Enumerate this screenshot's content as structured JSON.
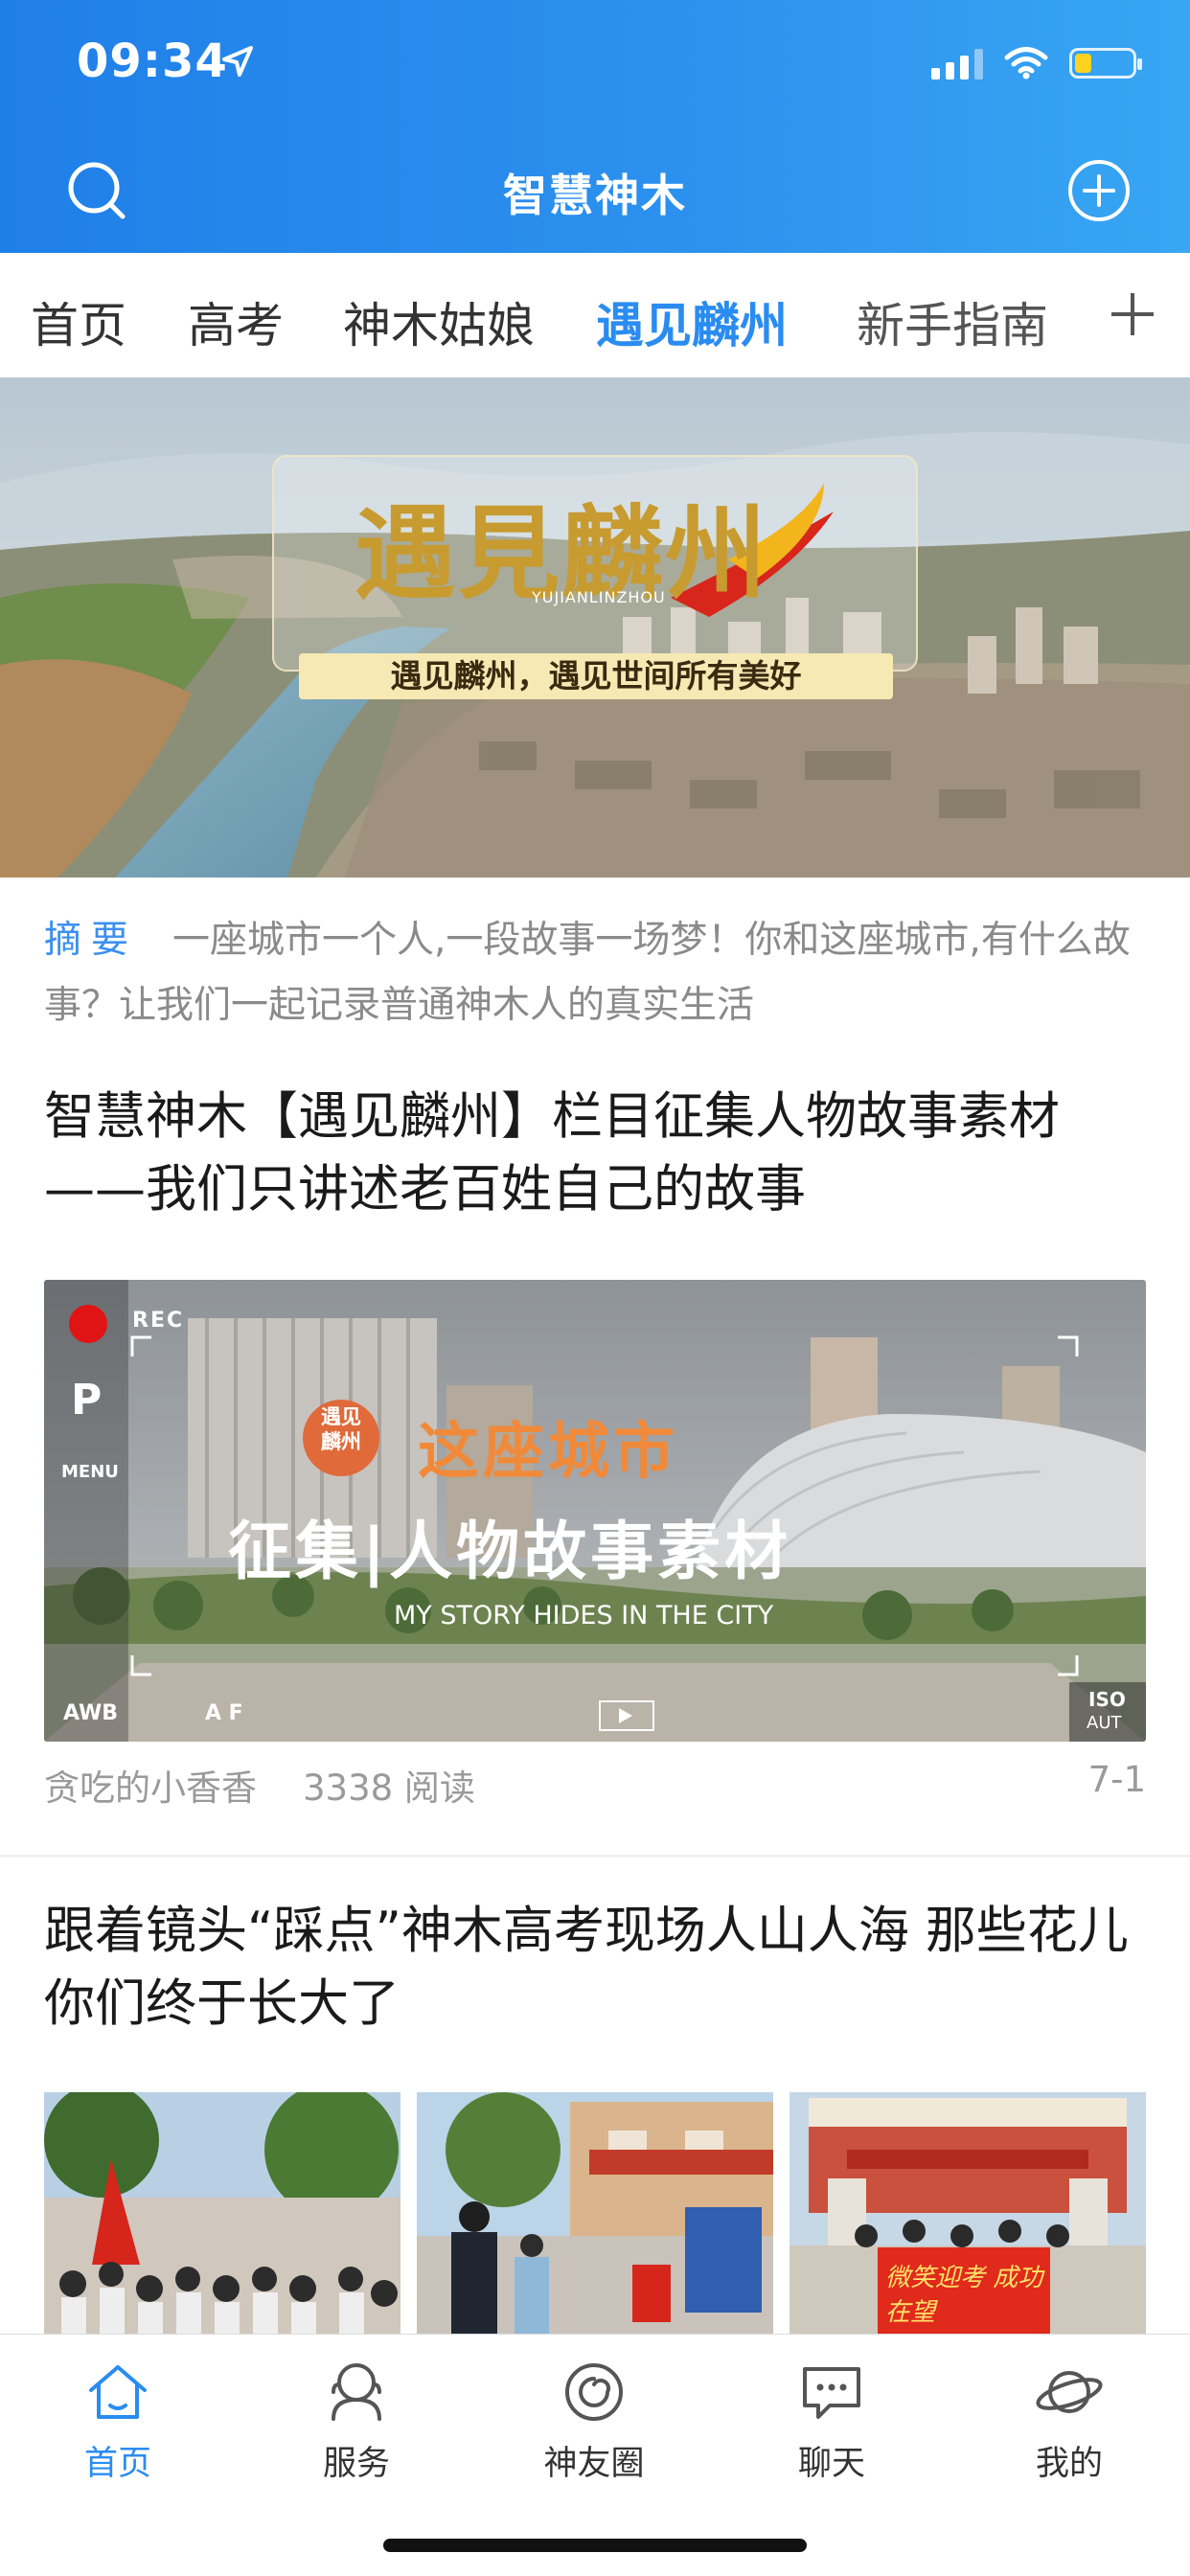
{
  "status_bar": {
    "time": "09:34",
    "battery_level": 0.3
  },
  "header": {
    "title": "智慧神木",
    "left_icon": "search-icon",
    "right_icon": "plus-circle-icon"
  },
  "tabs": [
    {
      "label": "首页",
      "active": false
    },
    {
      "label": "高考",
      "active": false
    },
    {
      "label": "神木姑娘",
      "active": false
    },
    {
      "label": "遇见麟州",
      "active": true
    },
    {
      "label": "新手指南",
      "active": false
    }
  ],
  "banner": {
    "main_text": "遇見麟州",
    "pinyin": "YUJIANLINZHOU",
    "subtitle": "遇见麟州，遇见世间所有美好"
  },
  "summary": {
    "label": "摘要",
    "text": "一座城市一个人,一段故事一场梦！你和这座城市,有什么故事？让我们一起记录普通神木人的真实生活"
  },
  "article1": {
    "title": "智慧神木【遇见麟州】栏目征集人物故事素材——我们只讲述老百姓自己的故事",
    "image": {
      "rec": "REC",
      "p": "P",
      "menu": "MENU",
      "awb": "AWB",
      "af": "A F",
      "iso": "ISO",
      "aut": "AUT",
      "badge_line1": "遇见",
      "badge_line2": "麟州",
      "headline": "这座城市",
      "sub_headline": "征集|人物故事素材",
      "english": "MY STORY HIDES IN THE CITY"
    },
    "author": "贪吃的小香香",
    "reads": "3338 阅读",
    "date": "7-1"
  },
  "article2": {
    "title": "跟着镜头“踩点”神木高考现场人山人海 那些花儿你们终于长大了",
    "thumb_banner_text": "微笑迎考 成功在望"
  },
  "bottom_nav": [
    {
      "label": "首页",
      "icon": "home-icon",
      "active": true
    },
    {
      "label": "服务",
      "icon": "service-icon",
      "active": false
    },
    {
      "label": "神友圈",
      "icon": "circle-icon",
      "active": false
    },
    {
      "label": "聊天",
      "icon": "chat-icon",
      "active": false
    },
    {
      "label": "我的",
      "icon": "planet-icon",
      "active": false
    }
  ],
  "colors": {
    "header": "#2d92ee",
    "accent": "#2a8cf0",
    "muted": "#9a9a9a"
  }
}
